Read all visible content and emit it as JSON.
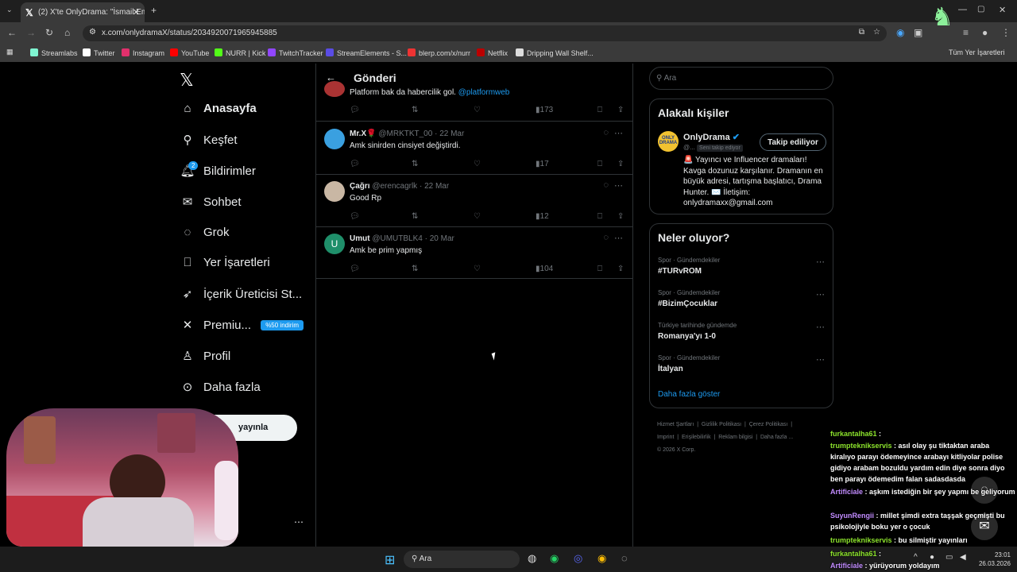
{
  "browser": {
    "tab_title": "(2) X'te OnlyDrama: \"İsmail Em",
    "url": "x.com/onlydramaX/status/2034920071965945885",
    "bookmarks": [
      "Streamlabs",
      "Twitter",
      "Instagram",
      "YouTube",
      "NURR | Kick",
      "TwitchTracker",
      "StreamElements - S...",
      "blerp.com/x/nurr",
      "Netflix",
      "Dripping Wall Shelf..."
    ],
    "all_bookmarks": "Tüm Yer İşaretleri"
  },
  "nav": {
    "items": [
      "Anasayfa",
      "Keşfet",
      "Bildirimler",
      "Sohbet",
      "Grok",
      "Yer İşaretleri",
      "İçerik Üreticisi St...",
      "Premiu...",
      "Profil",
      "Daha fazla"
    ],
    "premium_badge": "%50 indirim",
    "notif_count": "2",
    "post_button": "yayınla"
  },
  "header": {
    "title": "Gönderi"
  },
  "partial_post": {
    "text": "Platform bak da habercilik gol.",
    "mention": "@platformweb",
    "views": "173"
  },
  "replies": [
    {
      "name": "Mr.X🌹",
      "handle": "@MRKTKT_00",
      "date": "22 Mar",
      "text": "Amk sinirden cinsiyet değiştirdi.",
      "views": "17"
    },
    {
      "name": "Çağrı",
      "handle": "@erencagrlk",
      "date": "22 Mar",
      "text": "Good Rp",
      "views": "12"
    },
    {
      "name": "Umut",
      "handle": "@UMUTBLK4",
      "date": "20 Mar",
      "text": "Amk be prim yapmış",
      "views": "104"
    }
  ],
  "search": {
    "placeholder": "Ara"
  },
  "related": {
    "title": "Alakalı kişiler",
    "name": "OnlyDrama",
    "handle": "@...",
    "follows_you": "Seni takip ediyor",
    "follow_button": "Takip ediliyor",
    "bio": "🚨 Yayıncı ve Influencer dramaları! Kavga dozunuz karşılanır. Dramanın en büyük adresi, tartışma başlatıcı, Drama Hunter. ✉️ İletişim: onlydramaxx@gmail.com"
  },
  "trends": {
    "title": "Neler oluyor?",
    "items": [
      {
        "category": "Spor · Gündemdekiler",
        "topic": "#TURvROM"
      },
      {
        "category": "Spor · Gündemdekiler",
        "topic": "#BizimÇocuklar"
      },
      {
        "category": "Türkiye tarihinde gündemde",
        "topic": "Romanya'yı 1-0"
      },
      {
        "category": "Spor · Gündemdekiler",
        "topic": "İtalyan"
      }
    ],
    "show_more": "Daha fazla göster"
  },
  "footer": {
    "links": [
      "Hizmet Şartları",
      "|",
      "Gizlilik Politikası",
      "|",
      "Çerez Politikası",
      "|",
      "Imprint",
      "|",
      "Erişilebilirlik",
      "|",
      "Reklam bilgisi",
      "|",
      "Daha fazla ..."
    ],
    "copyright": "© 2026 X Corp."
  },
  "chat": [
    {
      "user": "furkantalha61",
      "msg": "",
      "color": "green"
    },
    {
      "user": "trumpteknikservis",
      "msg": "asıl olay şu tiktaktan araba kiralıyo parayı ödemeyince arabayı kitliyolar polise gidiyo arabam bozuldu yardım edin diye sonra diyo ben parayı ödemedim falan sadasdasda",
      "color": "green"
    },
    {
      "user": "Artificiale",
      "msg": "aşkım istediğin bir şey yapmı be geliyorum",
      "color": "purple"
    },
    {
      "user": "SuyunRengii",
      "msg": "millet şimdi extra taşşak geçmişti bu psikolojiyle boku yer o çocuk",
      "color": "purple"
    },
    {
      "user": "trumpteknikservis",
      "msg": "bu silmiştir yayınları",
      "color": "green"
    },
    {
      "user": "furkantalha61",
      "msg": "",
      "color": "green"
    },
    {
      "user": "Artificiale",
      "msg": "yürüyorum yoldayım",
      "color": "purple"
    }
  ],
  "taskbar": {
    "search": "Ara",
    "time": "23:01",
    "date": "26.03.2026"
  },
  "colors": {
    "accent": "#1d9bf0",
    "background": "#000000",
    "border": "#2f3336",
    "muted": "#71767b",
    "chat_green": "#8ce32c",
    "chat_purple": "#c28cff"
  }
}
